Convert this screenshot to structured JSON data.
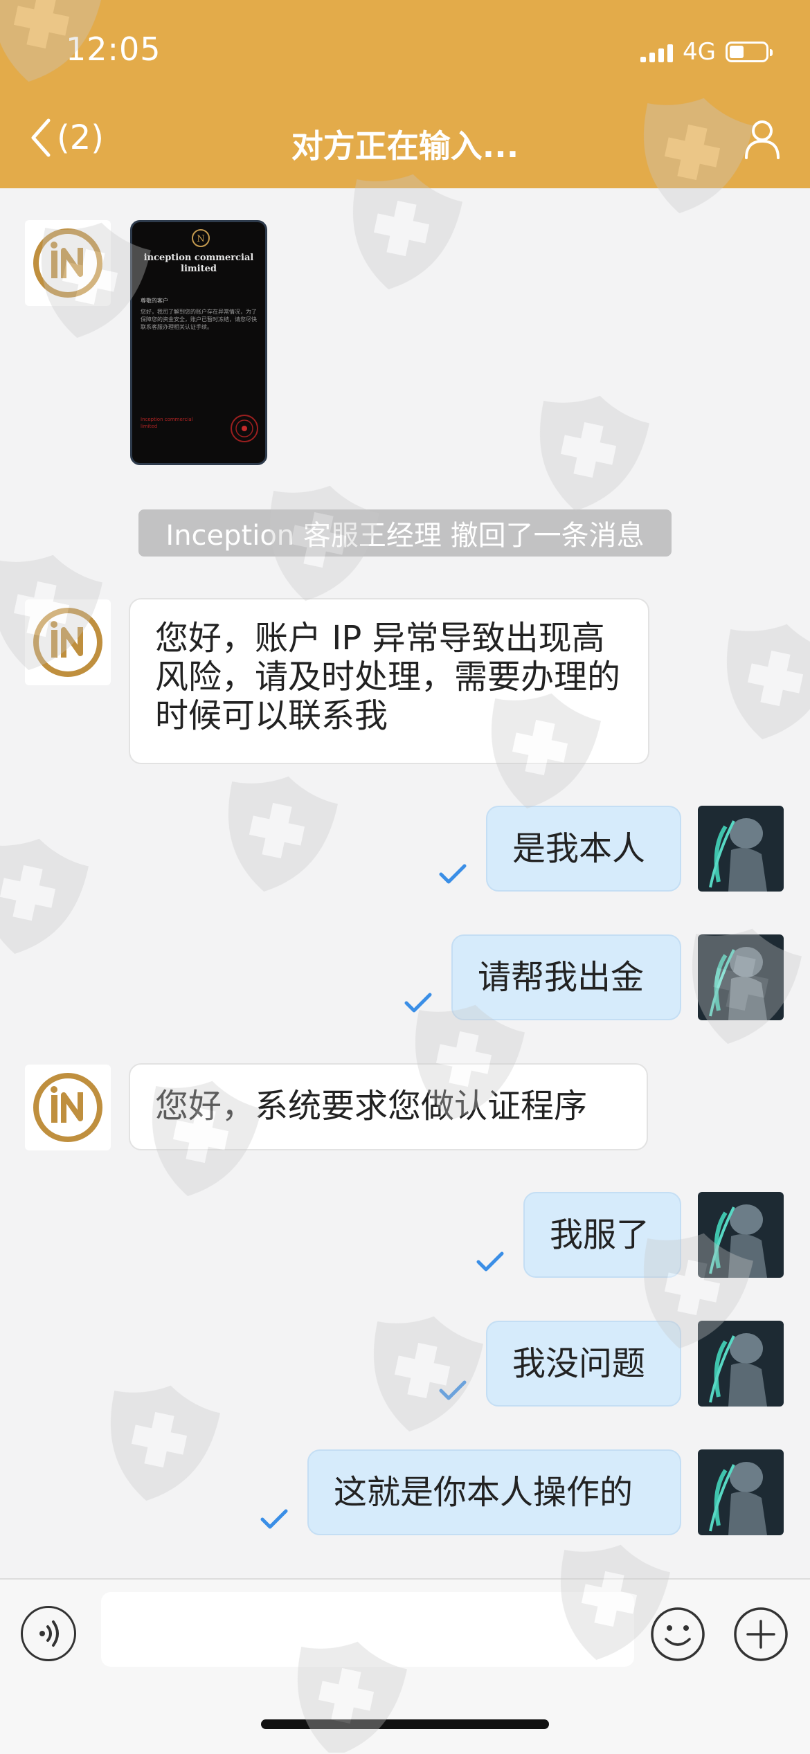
{
  "status_bar": {
    "time": "12:05",
    "network": "4G",
    "battery_level": 0.4
  },
  "header": {
    "back_label": "(2)",
    "title": "对方正在输入..."
  },
  "colors": {
    "header_bg": "#e3ab4a",
    "outgoing_bubble": "#d6ebfb",
    "check_blue": "#3a8ee6"
  },
  "messages": [
    {
      "type": "image",
      "from": "them",
      "card": {
        "title": "inception commercial limited",
        "greeting": "尊敬的客户",
        "body": "您好，我司了解到您的账户存在异常情况，为了保障您的资金安全，账户已暂时冻结，请您尽快联系客服办理相关认证手续。",
        "footer": "Inception commercial limited"
      }
    },
    {
      "type": "system",
      "text": "Inception 客服王经理 撤回了一条消息"
    },
    {
      "type": "text",
      "from": "them",
      "text": "您好，账户 IP 异常导致出现高风险，请及时处理，需要办理的时候可以联系我"
    },
    {
      "type": "text",
      "from": "me",
      "text": "是我本人"
    },
    {
      "type": "text",
      "from": "me",
      "text": "请帮我出金"
    },
    {
      "type": "text",
      "from": "them",
      "text": "您好，系统要求您做认证程序"
    },
    {
      "type": "text",
      "from": "me",
      "text": "我服了"
    },
    {
      "type": "text",
      "from": "me",
      "text": "我没问题"
    },
    {
      "type": "text",
      "from": "me",
      "text": "这就是你本人操作的"
    }
  ],
  "input": {
    "value": "",
    "placeholder": ""
  },
  "icons": {
    "back": "chevron-left-icon",
    "profile": "person-icon",
    "voice": "voice-icon",
    "emoji": "smiley-icon",
    "more": "plus-circle-icon",
    "read": "check-icon"
  }
}
